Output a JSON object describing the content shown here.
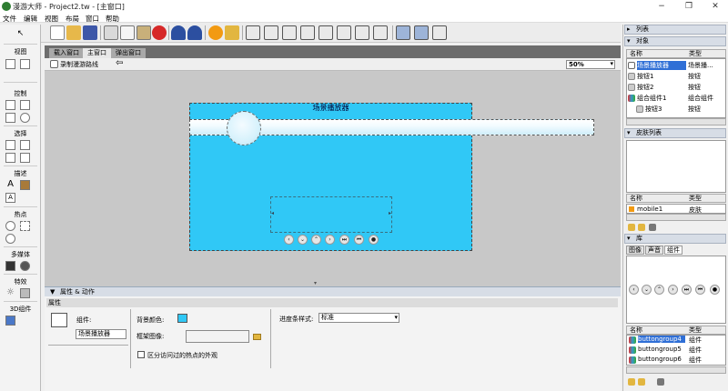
{
  "app": {
    "title": "漫游大师 - Project2.tw - [主窗口]",
    "brand_color": "#2e7d32"
  },
  "window_controls": {
    "minimize": "−",
    "restore": "❐",
    "close": "✕"
  },
  "menu": [
    "文件",
    "编辑",
    "视图",
    "布局",
    "窗口",
    "帮助"
  ],
  "toolbar": {
    "icons": [
      "new-file-icon",
      "open-folder-icon",
      "save-icon",
      "cut-icon",
      "copy-icon",
      "paste-icon",
      "delete-icon",
      "undo-icon",
      "redo-icon",
      "preview-icon",
      "publish-icon",
      "align-left-icon",
      "align-center-icon",
      "align-right-icon",
      "align-top-icon",
      "align-middle-icon",
      "align-bottom-icon",
      "same-width-icon",
      "same-height-icon",
      "distribute-h-icon",
      "distribute-v-icon"
    ]
  },
  "palette": {
    "sections": [
      "视图",
      "控制",
      "选择",
      "描述",
      "热点",
      "多媒体",
      "特效",
      "3D组件"
    ],
    "select_arrow": "↖"
  },
  "tabs": [
    "载入窗口",
    "主窗口",
    "弹出窗口"
  ],
  "docbar": {
    "record_label": "录制漫游路线",
    "back_arrow": "⇦",
    "zoom": "50%"
  },
  "stage": {
    "player_title": "场景播放器",
    "controls": [
      "‹",
      "⌄",
      "⌃",
      "›",
      "⏭",
      "⏮",
      "●"
    ],
    "player_color": "#30c8f6"
  },
  "properties": {
    "header": "属性 & 动作",
    "tab": "属性",
    "component_label": "组件:",
    "component_value": "场景播放器",
    "bg_color_label": "背景颜色:",
    "border_image_label": "框架图像:",
    "checkbox_label": "区分访问过的热点的外观",
    "progress_style_label": "进度条样式:",
    "progress_style_value": "标准"
  },
  "right": {
    "list_header": "列表",
    "objects_header": "对象",
    "col_name": "名称",
    "col_type": "类型",
    "objects": [
      {
        "name": "场景播放器",
        "type": "场景播..."
      },
      {
        "name": "按钮1",
        "type": "按钮"
      },
      {
        "name": "按钮2",
        "type": "按钮"
      },
      {
        "name": "组合组件1",
        "type": "组合组件"
      },
      {
        "name": "按钮3",
        "type": "按钮"
      }
    ],
    "skins_header": "皮肤列表",
    "skins": [
      {
        "name": "mobile1",
        "type": "皮肤"
      }
    ],
    "library_header": "库",
    "library_tabs": [
      "图像",
      "声音",
      "组件"
    ],
    "library_items": [
      {
        "name": "buttongroup4",
        "type": "组件"
      },
      {
        "name": "buttongroup5",
        "type": "组件"
      },
      {
        "name": "buttongroup6",
        "type": "组件"
      }
    ]
  }
}
